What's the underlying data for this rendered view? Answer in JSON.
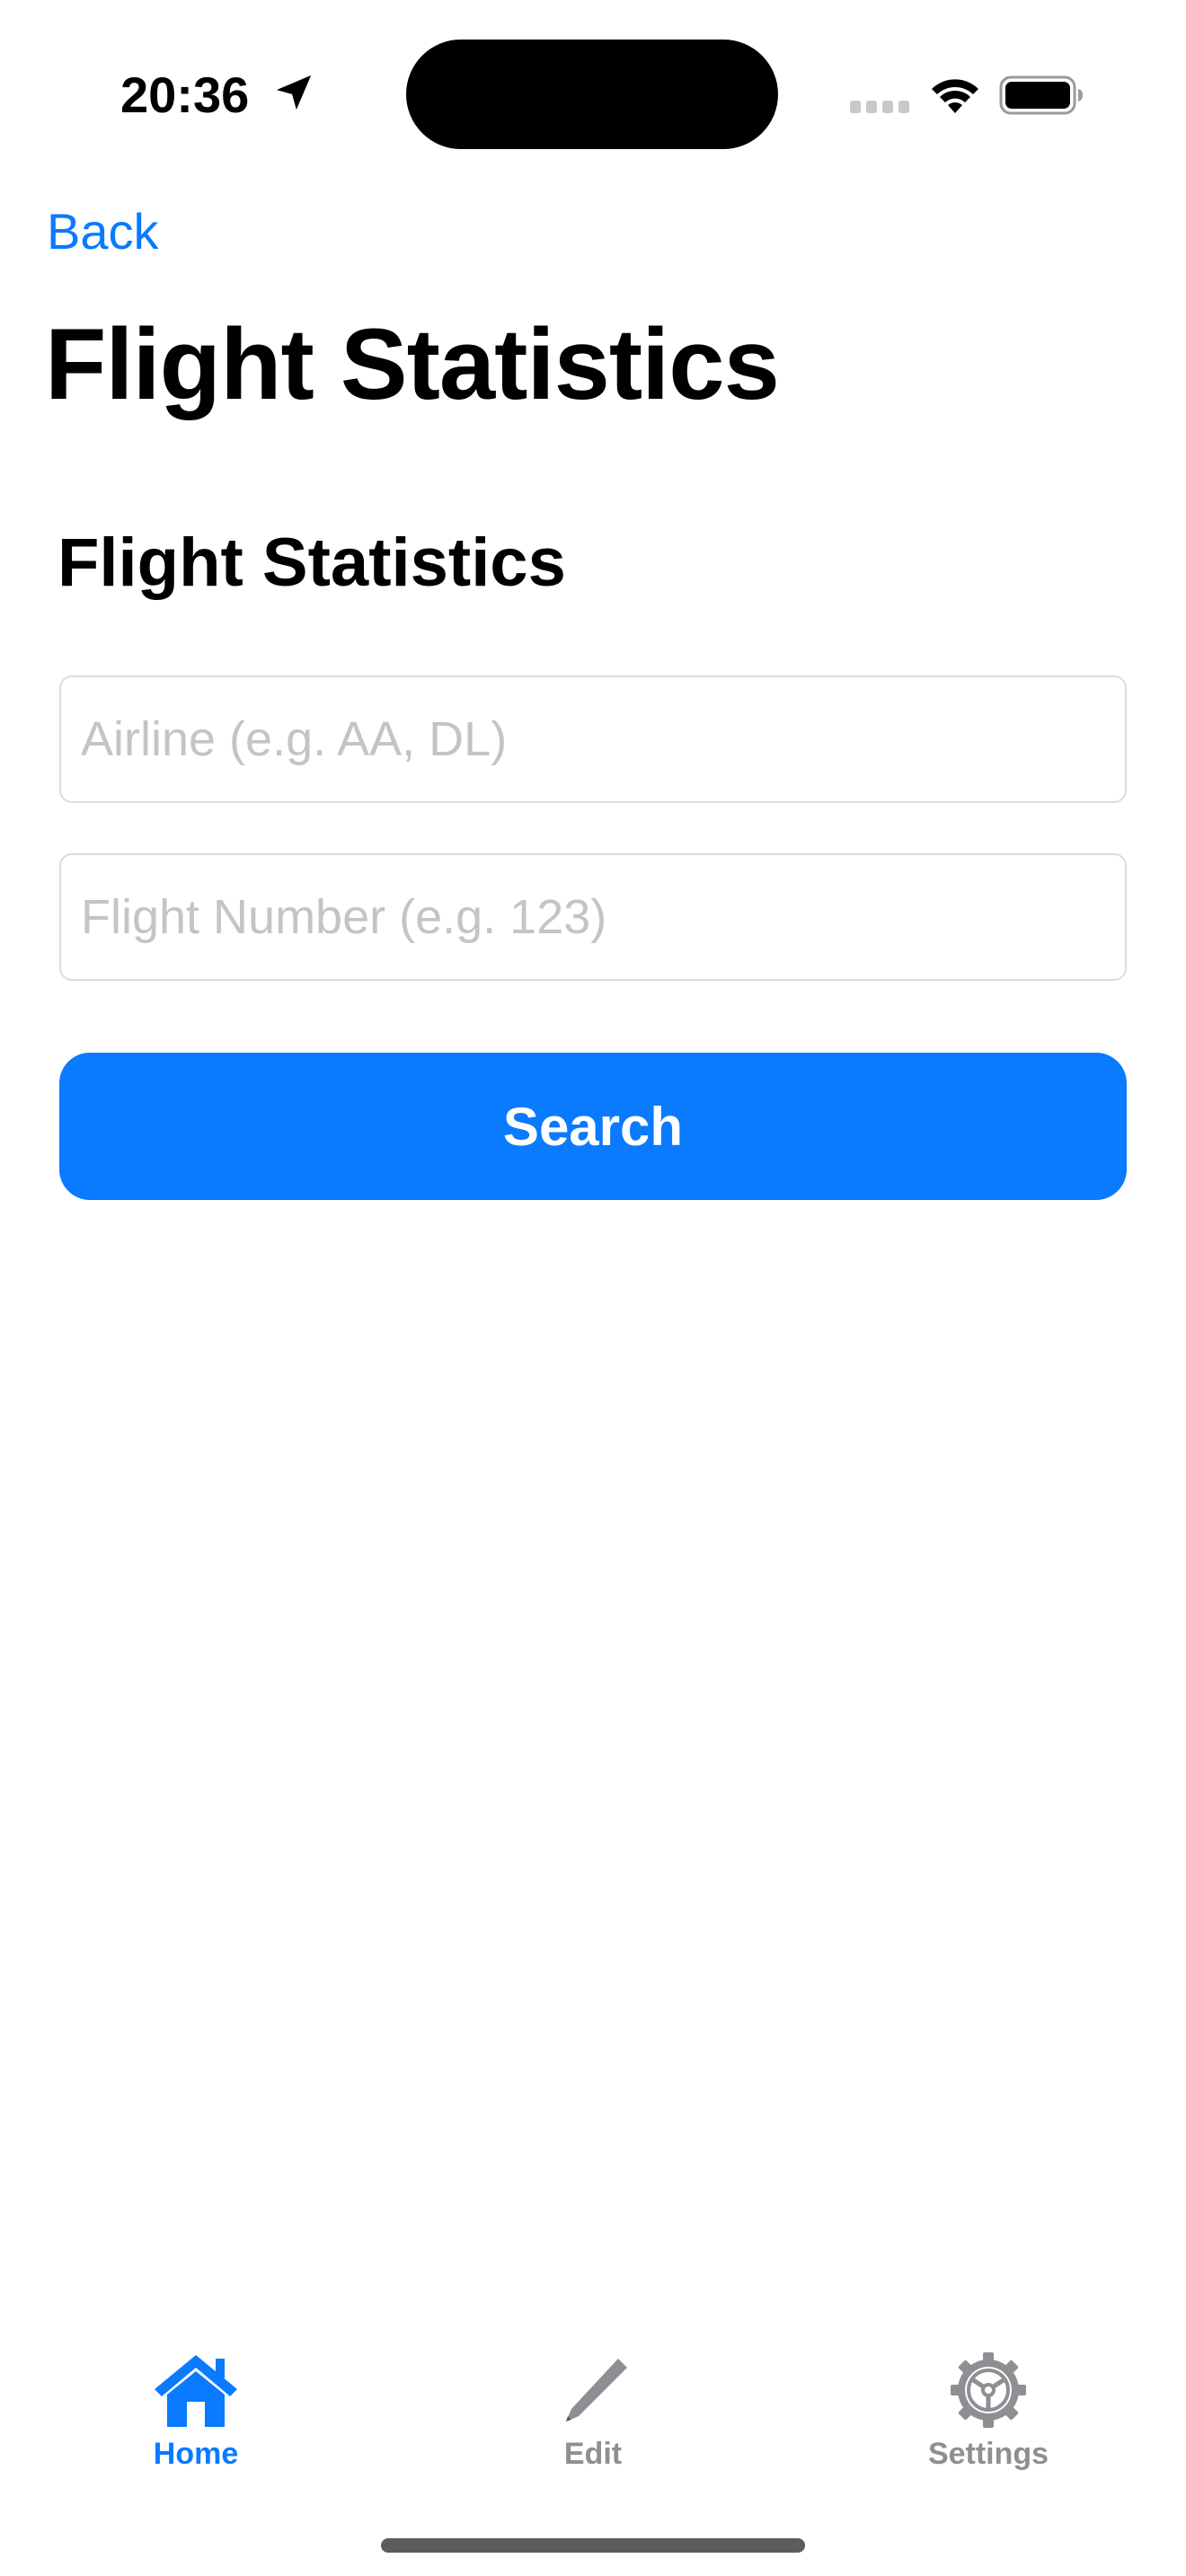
{
  "status_bar": {
    "time": "20:36",
    "icons": [
      "location-arrow-icon",
      "signal-icon",
      "wifi-icon",
      "battery-icon"
    ]
  },
  "nav": {
    "back_label": "Back",
    "large_title": "Flight Statistics"
  },
  "form": {
    "section_title": "Flight Statistics",
    "airline_placeholder": "Airline (e.g. AA, DL)",
    "airline_value": "",
    "flight_number_placeholder": "Flight Number (e.g. 123)",
    "flight_number_value": "",
    "search_label": "Search"
  },
  "tab_bar": {
    "items": [
      {
        "label": "Home",
        "icon": "house-icon",
        "active": true
      },
      {
        "label": "Edit",
        "icon": "pencil-icon",
        "active": false
      },
      {
        "label": "Settings",
        "icon": "gear-icon",
        "active": false
      }
    ]
  },
  "colors": {
    "accent": "#0a7aff",
    "inactive_tab": "#8e8e93",
    "placeholder": "#c4c4c7",
    "field_border": "#dcdcdf"
  }
}
